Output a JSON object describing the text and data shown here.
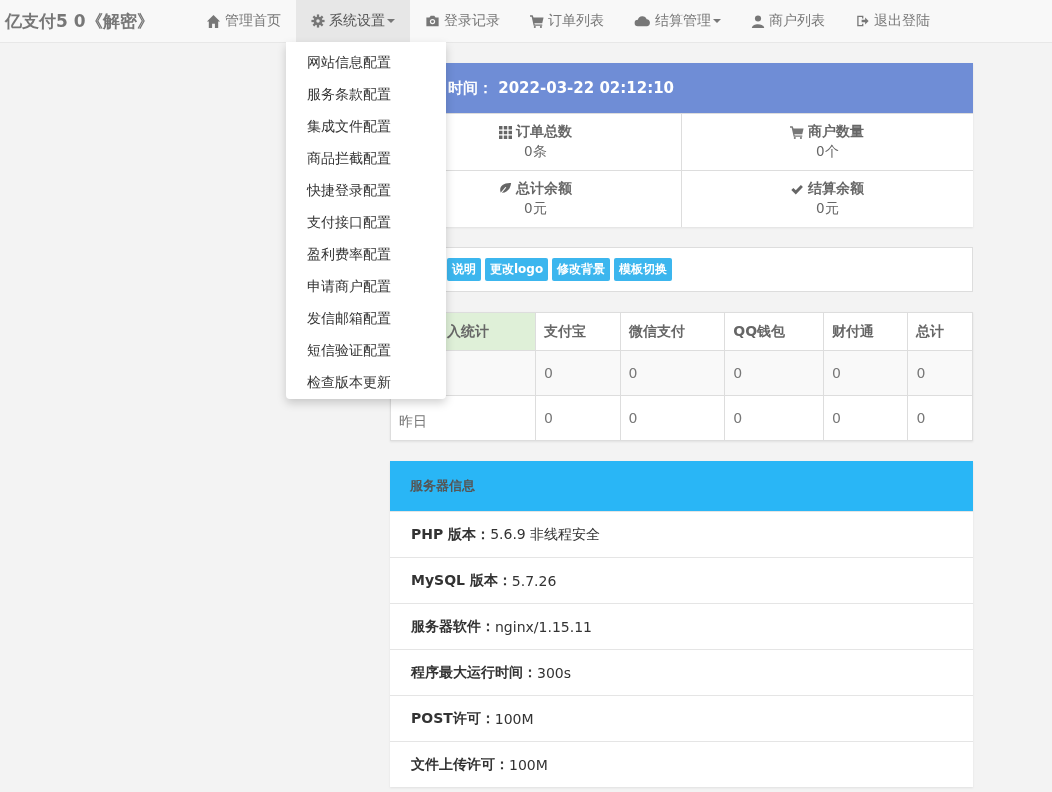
{
  "navbar": {
    "brand": "亿支付5 0《解密》",
    "items": [
      {
        "label": "管理首页",
        "kind": "home",
        "selected": false,
        "dropdown": false
      },
      {
        "label": "系统设置",
        "kind": "gear",
        "selected": true,
        "dropdown": true
      },
      {
        "label": "登录记录",
        "kind": "camera",
        "selected": false,
        "dropdown": false
      },
      {
        "label": "订单列表",
        "kind": "cart",
        "selected": false,
        "dropdown": false
      },
      {
        "label": "结算管理",
        "kind": "cloud",
        "selected": false,
        "dropdown": true
      },
      {
        "label": "商户列表",
        "kind": "user",
        "selected": false,
        "dropdown": false
      },
      {
        "label": "退出登陆",
        "kind": "logout",
        "selected": false,
        "dropdown": false
      }
    ]
  },
  "dropdown_menu": {
    "items": [
      "网站信息配置",
      "服务条款配置",
      "集成文件配置",
      "商品拦截配置",
      "快捷登录配置",
      "支付接口配置",
      "盈利费率配置",
      "申请商户配置",
      "发信邮箱配置",
      "短信验证配置",
      "检查版本更新"
    ]
  },
  "overview_panel": {
    "title": "时间： 2022-03-22 02:12:10",
    "stats": [
      {
        "kind": "grid",
        "label": "订单总数",
        "value": "0条"
      },
      {
        "kind": "cart",
        "label": "商户数量",
        "value": "0个"
      },
      {
        "kind": "leaf",
        "label": "总计余额",
        "value": "0元"
      },
      {
        "kind": "check",
        "label": "结算余额",
        "value": "0元"
      }
    ]
  },
  "quick_buttons": [
    "说明",
    "更改logo",
    "修改背景",
    "模板切换"
  ],
  "income_table": {
    "columns": [
      {
        "label": "入统计",
        "highlighted": true
      },
      {
        "label": "支付宝",
        "highlighted": false
      },
      {
        "label": "微信支付",
        "highlighted": false
      },
      {
        "label": "QQ钱包",
        "highlighted": false
      },
      {
        "label": "财付通",
        "highlighted": false
      },
      {
        "label": "总计",
        "highlighted": false
      }
    ],
    "rows": [
      [
        "",
        "0",
        "0",
        "0",
        "0",
        "0"
      ],
      [
        "昨日",
        "0",
        "0",
        "0",
        "0",
        "0"
      ]
    ]
  },
  "server_panel": {
    "title": "服务器信息",
    "rows": [
      {
        "label": "PHP 版本：",
        "value": "5.6.9 非线程安全"
      },
      {
        "label": "MySQL 版本：",
        "value": "5.7.26"
      },
      {
        "label": "服务器软件：",
        "value": "nginx/1.15.11"
      },
      {
        "label": "程序最大运行时间：",
        "value": "300s"
      },
      {
        "label": "POST许可：",
        "value": "100M"
      },
      {
        "label": "文件上传许可：",
        "value": "100M"
      }
    ]
  }
}
